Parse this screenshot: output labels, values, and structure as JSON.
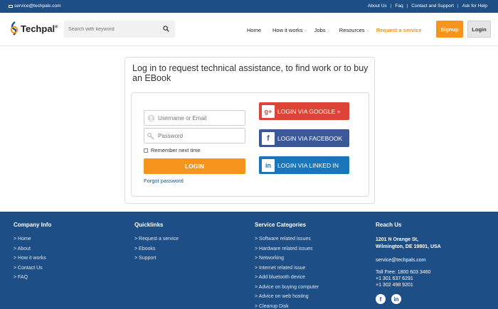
{
  "topbar": {
    "email": "service@techpals.com",
    "links": [
      "About Us",
      "Faq",
      "Contact and Support",
      "Ask for Help"
    ]
  },
  "header": {
    "logo_text": "Techpal",
    "logo_reg": "®",
    "search_placeholder": "Search with keyword",
    "nav": [
      {
        "label": "Home",
        "caret": false
      },
      {
        "label": "How it works",
        "caret": true
      },
      {
        "label": "Jobs",
        "caret": true
      },
      {
        "label": "Resources",
        "caret": true
      },
      {
        "label": "Request a service",
        "caret": false,
        "accent": true
      }
    ],
    "signup_label": "Signup",
    "login_label": "Login"
  },
  "login": {
    "title": "Log in to request technical assistance, to find work or to buy an EBook",
    "username_placeholder": "Username or Email",
    "password_placeholder": "Password",
    "remember_label": "Remember next time",
    "login_button": "LOGIN",
    "forgot_label": "Forgot password",
    "google_label": "LOGIN VIA GOOGLE +",
    "facebook_label": "LOGIN VIA FACEBOOK",
    "linkedin_label": "LOGIN VIA LINKED IN"
  },
  "footer": {
    "company": {
      "heading": "Company Info",
      "links": [
        "> Home",
        "> About",
        "> How it works",
        "> Contact Us",
        "> FAQ"
      ]
    },
    "quicklinks": {
      "heading": "Quicklinks",
      "links": [
        "> Request a service",
        "> Ebooks",
        "> Support"
      ]
    },
    "services": {
      "heading": "Service Categories",
      "links": [
        "> Software related issues",
        "> Hardware related issues",
        "> Networking",
        "> Internet related issue",
        "> Add bluetooth device",
        "> Advice on buying computer",
        "> Advice on web hosting",
        "> Cleanup Disk"
      ]
    },
    "reach": {
      "heading": "Reach Us",
      "address_line1": "1201 N Orange St,",
      "address_line2": "Wilmington, DE 19801, USA",
      "email": "service@techpals.com",
      "toll_free": "Toll Free: 1800 603 3460",
      "phone1": "+1 301 637 6291",
      "phone2": "+1 302 498 9201"
    }
  },
  "colors": {
    "brand_blue": "#1e4e86",
    "accent_orange": "#f7941d",
    "google_red": "#dc4437",
    "facebook_blue": "#3b5998",
    "linkedin_blue": "#1a75b9"
  }
}
